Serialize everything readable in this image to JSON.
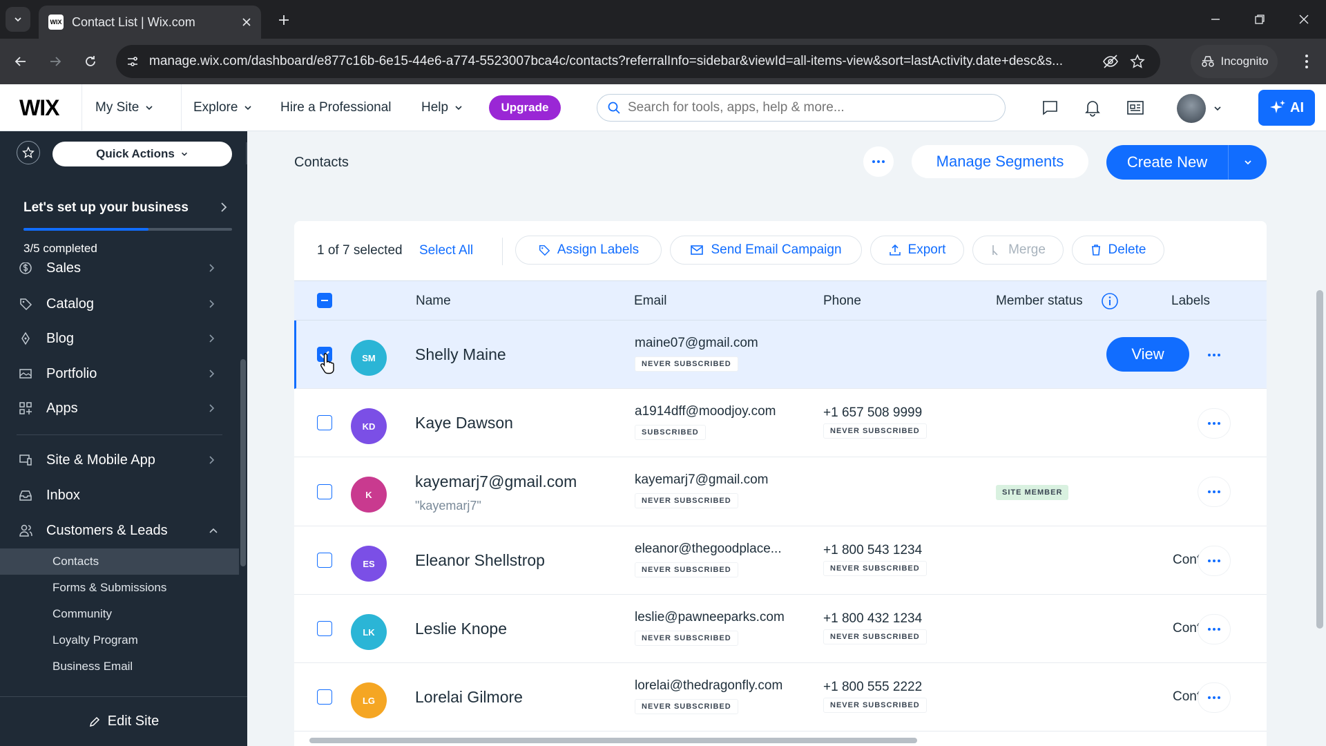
{
  "browser": {
    "tab_title": "Contact List | Wix.com",
    "url": "manage.wix.com/dashboard/e877c16b-6e15-44e6-a774-5523007bca4c/contacts?referralInfo=sidebar&viewId=all-items-view&sort=lastActivity.date+desc&s...",
    "incognito_label": "Incognito",
    "favicon_text": "WIX"
  },
  "header": {
    "logo": "WIX",
    "my_site": "My Site",
    "explore": "Explore",
    "hire": "Hire a Professional",
    "help": "Help",
    "upgrade": "Upgrade",
    "search_placeholder": "Search for tools, apps, help & more...",
    "ai_label": "AI"
  },
  "sidebar": {
    "quick_actions": "Quick Actions",
    "setup_title": "Let's set up your business",
    "setup_progress": 0.6,
    "setup_done": "3/5 completed",
    "items": [
      {
        "label": "Sales"
      },
      {
        "label": "Catalog"
      },
      {
        "label": "Blog"
      },
      {
        "label": "Portfolio"
      },
      {
        "label": "Apps"
      },
      {
        "label": "Site & Mobile App"
      },
      {
        "label": "Inbox"
      },
      {
        "label": "Customers & Leads"
      }
    ],
    "subitems": [
      {
        "label": "Contacts",
        "active": true
      },
      {
        "label": "Forms & Submissions"
      },
      {
        "label": "Community"
      },
      {
        "label": "Loyalty Program"
      },
      {
        "label": "Business Email"
      }
    ],
    "edit_site": "Edit Site"
  },
  "main": {
    "title": "Contacts",
    "manage_segments": "Manage Segments",
    "create_new": "Create New",
    "bulk": {
      "selected": "1 of 7 selected",
      "select_all": "Select All",
      "assign_labels": "Assign Labels",
      "send_email": "Send Email Campaign",
      "export": "Export",
      "merge": "Merge",
      "delete": "Delete"
    },
    "columns": {
      "name": "Name",
      "email": "Email",
      "phone": "Phone",
      "member_status": "Member status",
      "labels": "Labels"
    },
    "view_button": "View",
    "rows": [
      {
        "initials": "SM",
        "color": "#2bb5d6",
        "name": "Shelly Maine",
        "nickname": "",
        "email": "maine07@gmail.com",
        "email_status": "NEVER SUBSCRIBED",
        "phone": "",
        "phone_status": "",
        "member": "",
        "label": "",
        "selected": true
      },
      {
        "initials": "KD",
        "color": "#7b4fe6",
        "name": "Kaye Dawson",
        "nickname": "",
        "email": "a1914dff@moodjoy.com",
        "email_status": "SUBSCRIBED",
        "phone": "+1 657 508 9999",
        "phone_status": "NEVER SUBSCRIBED",
        "member": "",
        "label": ""
      },
      {
        "initials": "K",
        "color": "#c93a8f",
        "name": "kayemarj7@gmail.com",
        "nickname": "\"kayemarj7\"",
        "email": "kayemarj7@gmail.com",
        "email_status": "NEVER SUBSCRIBED",
        "phone": "",
        "phone_status": "",
        "member": "SITE MEMBER",
        "label": ""
      },
      {
        "initials": "ES",
        "color": "#7b4fe6",
        "name": "Eleanor Shellstrop",
        "nickname": "",
        "email": "eleanor@thegoodplace...",
        "email_status": "NEVER SUBSCRIBED",
        "phone": "+1 800 543 1234",
        "phone_status": "NEVER SUBSCRIBED",
        "member": "",
        "label": "Conta"
      },
      {
        "initials": "LK",
        "color": "#2bb5d6",
        "name": "Leslie Knope",
        "nickname": "",
        "email": "leslie@pawneeparks.com",
        "email_status": "NEVER SUBSCRIBED",
        "phone": "+1 800 432 1234",
        "phone_status": "NEVER SUBSCRIBED",
        "member": "",
        "label": "Conta"
      },
      {
        "initials": "LG",
        "color": "#f5a623",
        "name": "Lorelai Gilmore",
        "nickname": "",
        "email": "lorelai@thedragonfly.com",
        "email_status": "NEVER SUBSCRIBED",
        "phone": "+1 800 555 2222",
        "phone_status": "NEVER SUBSCRIBED",
        "member": "",
        "label": "Conta"
      }
    ]
  },
  "colors": {
    "accent": "#116dff",
    "sidebar": "#1f2a36",
    "upgrade": "#9a27d5"
  }
}
